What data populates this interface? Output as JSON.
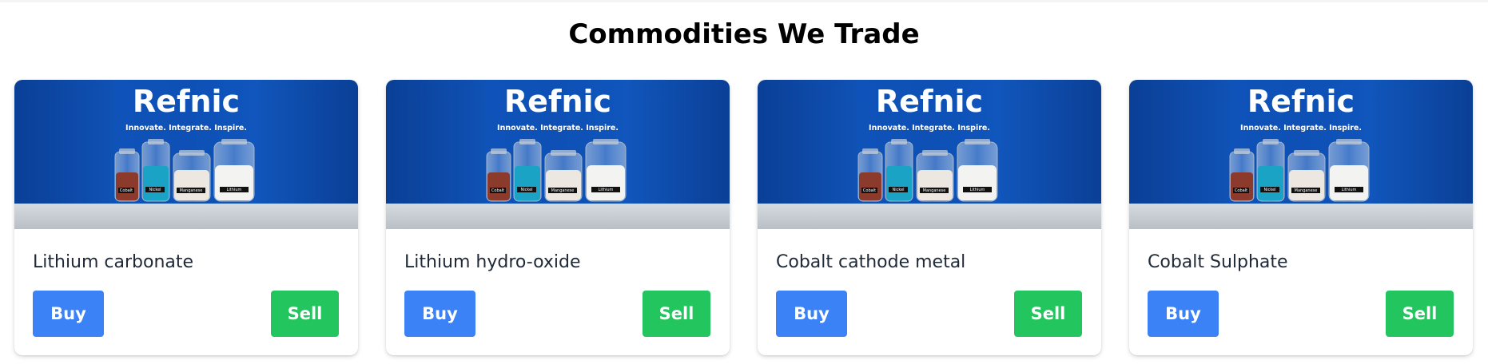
{
  "page": {
    "title": "Commodities We Trade"
  },
  "colors": {
    "buy": "#3b82f6",
    "sell": "#22c55e",
    "banner": "#0d4aa8"
  },
  "banner": {
    "brand": "Refnic",
    "tagline": "Innovate. Integrate. Inspire.",
    "jar_labels": [
      "Cobalt",
      "Nickel",
      "Manganese",
      "Lithium"
    ]
  },
  "products": [
    {
      "name": "Lithium carbonate",
      "buy_label": "Buy",
      "sell_label": "Sell"
    },
    {
      "name": "Lithium hydro-oxide",
      "buy_label": "Buy",
      "sell_label": "Sell"
    },
    {
      "name": "Cobalt cathode metal",
      "buy_label": "Buy",
      "sell_label": "Sell"
    },
    {
      "name": "Cobalt Sulphate",
      "buy_label": "Buy",
      "sell_label": "Sell"
    }
  ]
}
